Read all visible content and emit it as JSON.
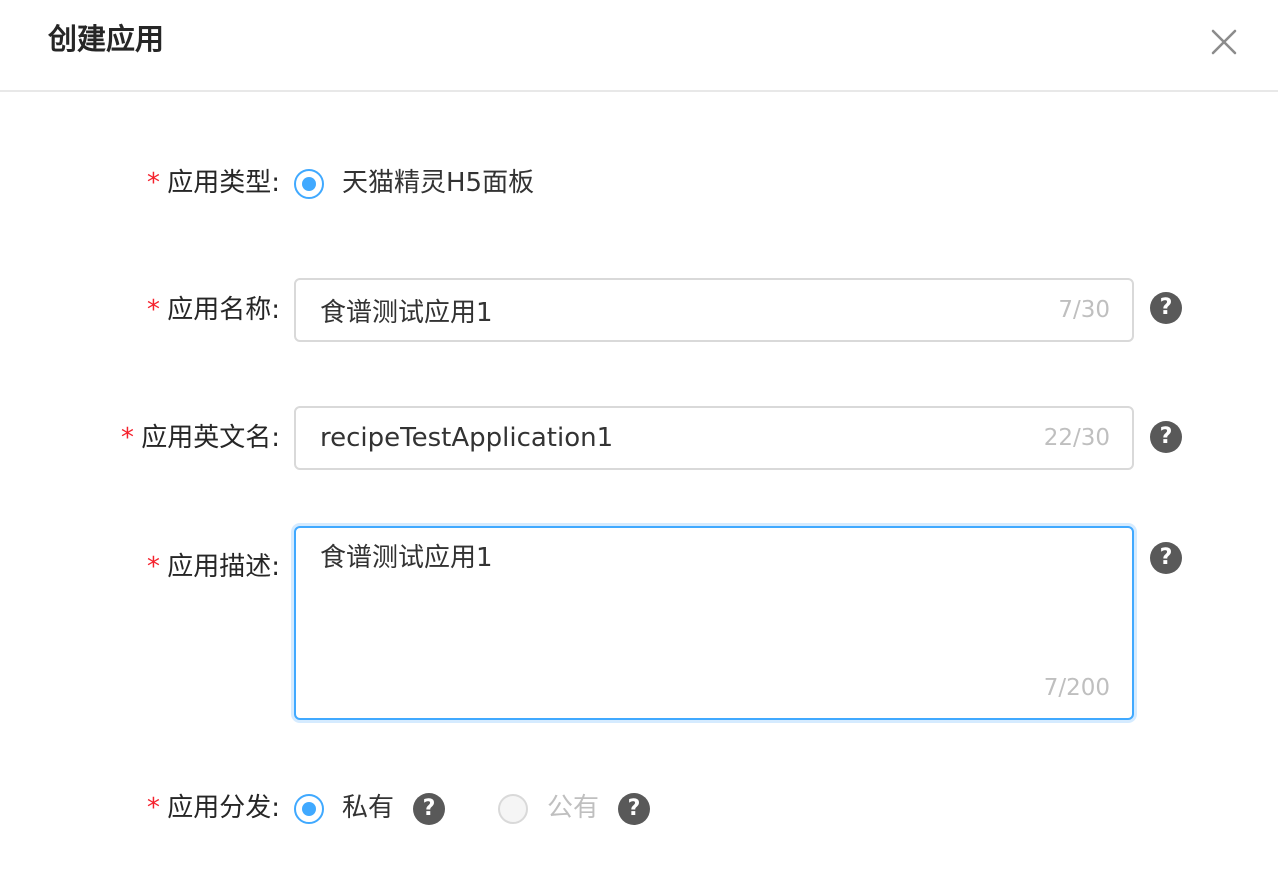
{
  "dialog": {
    "title": "创建应用",
    "close_icon": "close-icon"
  },
  "form": {
    "required_mark": "*",
    "app_type": {
      "label": "应用类型:",
      "option": "天猫精灵H5面板",
      "selected": true
    },
    "app_name": {
      "label": "应用名称:",
      "value": "食谱测试应用1",
      "counter": "7/30",
      "help_icon": "question-icon",
      "help_text": "?"
    },
    "app_english_name": {
      "label": "应用英文名:",
      "value": "recipeTestApplication1",
      "counter": "22/30",
      "help_icon": "question-icon",
      "help_text": "?"
    },
    "app_description": {
      "label": "应用描述:",
      "value": "食谱测试应用1",
      "counter": "7/200",
      "help_icon": "question-icon",
      "help_text": "?"
    },
    "app_distribution": {
      "label": "应用分发:",
      "options": [
        {
          "label": "私有",
          "selected": true,
          "disabled": false,
          "help_text": "?"
        },
        {
          "label": "公有",
          "selected": false,
          "disabled": true,
          "help_text": "?"
        }
      ]
    }
  },
  "colors": {
    "primary": "#40a9ff",
    "required": "#f5222d",
    "help_bg": "#595959",
    "placeholder": "#bfbfbf"
  }
}
